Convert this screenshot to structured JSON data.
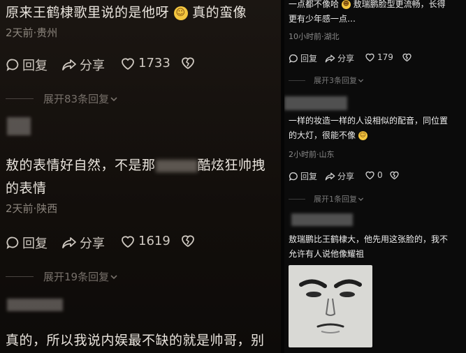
{
  "left": {
    "comment1": {
      "text_a": "原来王鹤棣歌里说的是他呀",
      "text_b": "真的蛮像",
      "meta": "2天前·贵州",
      "reply_label": "回复",
      "share_label": "分享",
      "likes": "1733"
    },
    "expand1": {
      "label": "展开83条回复"
    },
    "comment2": {
      "line1_a": "敖的表情好自然，不是那",
      "line1_b": "酷炫狂帅拽",
      "line2": "的表情",
      "meta": "2天前·陕西",
      "reply_label": "回复",
      "share_label": "分享",
      "likes": "1619"
    },
    "expand2": {
      "label": "展开19条回复"
    },
    "comment3": {
      "text": "真的，所以我说内娱最不缺的就是帅哥，别"
    }
  },
  "right": {
    "comment1": {
      "line1_a": "一点都不像哈",
      "line1_b": "敖瑞鹏脸型更流畅，长得",
      "line2": "更有少年感一点…",
      "meta": "10小时前·湖北",
      "reply_label": "回复",
      "share_label": "分享",
      "likes": "179"
    },
    "expand1": {
      "label": "展开3条回复"
    },
    "comment2": {
      "line1": "一样的妆造一样的人设相似的配音，同位置",
      "line2_a": "的大灯，很能不像",
      "meta": "2小时前·山东",
      "reply_label": "回复",
      "share_label": "分享",
      "likes": "0"
    },
    "expand2": {
      "label": "展开1条回复"
    },
    "comment3": {
      "line1": "敖瑞鹏比王鹤棣大，他先用这张脸的，我不",
      "line2": "允许有人说他像耀祖"
    }
  },
  "icons": [
    "reply-icon",
    "share-icon",
    "heart-icon",
    "broken-heart-icon",
    "chevron-down-icon",
    "smile-emoji-icon",
    "laugh-cry-emoji-icon",
    "drool-emoji-icon"
  ],
  "colors": {
    "left_bg": "#16120f",
    "right_bg": "#0b0b0b",
    "text": "#e9e4dd",
    "meta": "#8c857d"
  }
}
